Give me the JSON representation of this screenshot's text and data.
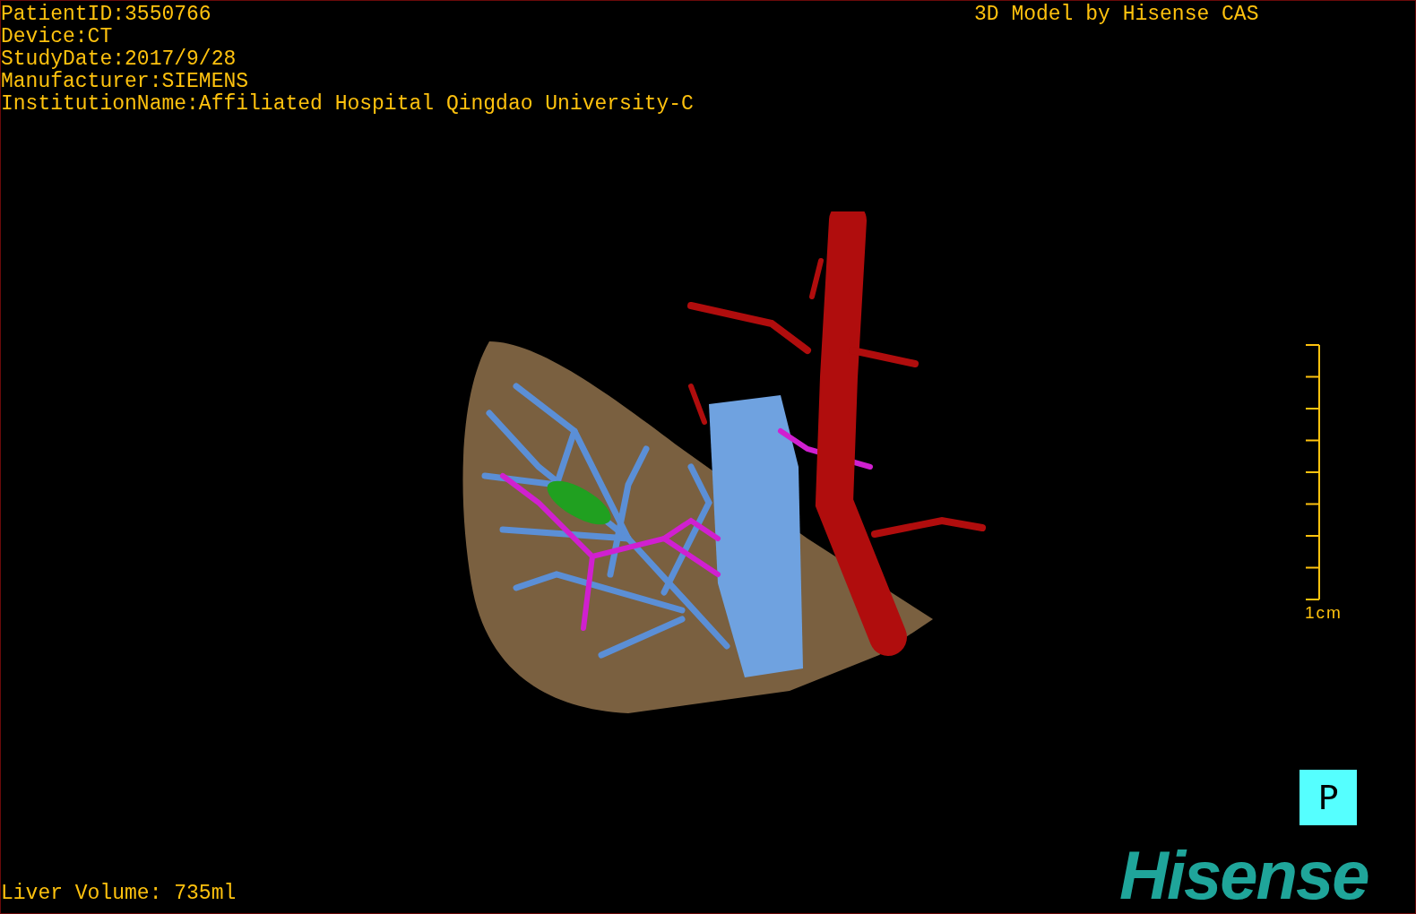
{
  "patient_info": [
    "PatientID:3550766",
    "Device:CT",
    "StudyDate:2017/9/28",
    "Manufacturer:SIEMENS",
    "InstitutionName:Affiliated Hospital Qingdao University-C"
  ],
  "model_title": "3D Model by Hisense CAS",
  "scale_bar": {
    "label": "1cm"
  },
  "orientation_marker": "P",
  "liver_volume": "Liver Volume: 735ml",
  "logo": "Hisense"
}
